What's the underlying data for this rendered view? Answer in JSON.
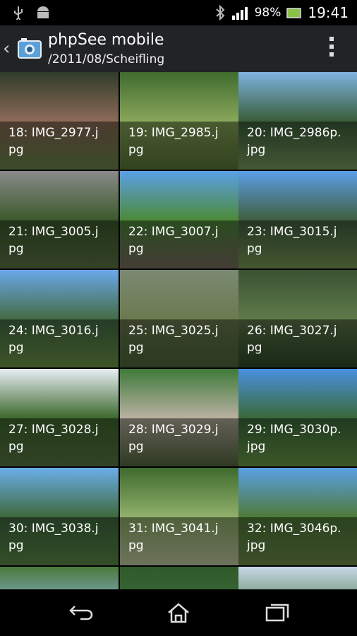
{
  "status_bar": {
    "battery": "98%",
    "time": "19:41",
    "icons": [
      "usb-icon",
      "android-debug-icon",
      "bluetooth-icon",
      "signal-icon",
      "battery-icon"
    ]
  },
  "action_bar": {
    "title": "phpSee mobile",
    "subtitle": "/2011/08/Scheifling",
    "icons": [
      "up-icon",
      "app-icon",
      "overflow-menu-icon"
    ]
  },
  "grid": {
    "items": [
      {
        "caption": "18: IMG_2977.j\npg"
      },
      {
        "caption": "19: IMG_2985.j\npg"
      },
      {
        "caption": "20: IMG_2986p.\njpg"
      },
      {
        "caption": "21: IMG_3005.j\npg"
      },
      {
        "caption": "22: IMG_3007.j\npg"
      },
      {
        "caption": "23: IMG_3015.j\npg"
      },
      {
        "caption": "24: IMG_3016.j\npg"
      },
      {
        "caption": "25: IMG_3025.j\npg"
      },
      {
        "caption": "26: IMG_3027.j\npg"
      },
      {
        "caption": "27: IMG_3028.j\npg"
      },
      {
        "caption": "28: IMG_3029.j\npg"
      },
      {
        "caption": "29: IMG_3030p.\njpg"
      },
      {
        "caption": "30: IMG_3038.j\npg"
      },
      {
        "caption": "31: IMG_3041.j\npg"
      },
      {
        "caption": "32: IMG_3046p.\njpg"
      },
      {
        "caption": ""
      },
      {
        "caption": ""
      },
      {
        "caption": ""
      }
    ]
  },
  "nav_bar": {
    "icons": [
      "back-icon",
      "home-icon",
      "recent-apps-icon"
    ]
  }
}
